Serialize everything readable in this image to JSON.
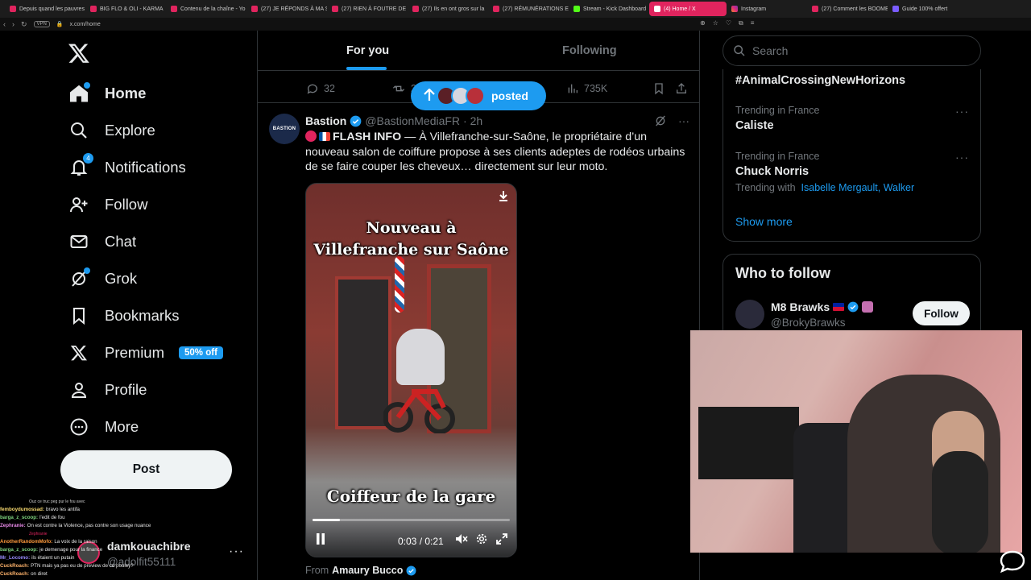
{
  "browser": {
    "tabs": [
      {
        "label": "Depuis quand les pauvres",
        "kind": "yt"
      },
      {
        "label": "BIG FLO & OLI - KARMA",
        "kind": "yt"
      },
      {
        "label": "Contenu de la chaîne - Yo",
        "kind": "yt"
      },
      {
        "label": "(27) JE RÉPONDS À MA S",
        "kind": "yt"
      },
      {
        "label": "(27) RIEN À FOUTRE DE T",
        "kind": "yt"
      },
      {
        "label": "(27) Ils en ont gros sur la",
        "kind": "yt"
      },
      {
        "label": "(27) RÉMUNÉRATIONS ET",
        "kind": "yt"
      },
      {
        "label": "Stream - Kick Dashboard",
        "kind": "kick"
      },
      {
        "label": "(4) Home / X",
        "kind": "x",
        "active": true
      },
      {
        "label": "Instagram",
        "kind": "insta"
      },
      {
        "label": "(27) Comment les BOOME",
        "kind": "yt"
      },
      {
        "label": "Guide 100% offert",
        "kind": "guide"
      }
    ],
    "vpn": "VPN",
    "url": "x.com/home"
  },
  "nav": {
    "home": "Home",
    "explore": "Explore",
    "notifications": "Notifications",
    "notifications_count": "4",
    "follow": "Follow",
    "chat": "Chat",
    "grok": "Grok",
    "bookmarks": "Bookmarks",
    "premium": "Premium",
    "premium_badge": "50% off",
    "profile": "Profile",
    "more": "More",
    "post_button": "Post"
  },
  "account": {
    "name": "damkouachibre",
    "handle": "@adolfit55111",
    "more": "···"
  },
  "chat_overlay": [
    {
      "user": "",
      "color": "#ccc",
      "text": "Ouz ce truc peg pur le fou avec"
    },
    {
      "user": "femboydumossad:",
      "color": "#f5d76e",
      "text": "bravo les antifa"
    },
    {
      "user": "barga_z_scoop:",
      "color": "#7fd37f",
      "text": "l'edit de fou"
    },
    {
      "user": "Zephranie:",
      "color": "#e889e8",
      "text": "On est contre la Violence, pas contre son usage nuance"
    },
    {
      "user": "",
      "color": "#e0245e",
      "text": "Zephranie"
    },
    {
      "user": "AnotherRandomMofo:",
      "color": "#ff9a3c",
      "text": "La voix de la raison"
    },
    {
      "user": "barga_z_scoop:",
      "color": "#7fd37f",
      "text": "je demenage  pour la finance"
    },
    {
      "user": "Mr_Locomo:",
      "color": "#9a8cff",
      "text": "ils étaient un putain"
    },
    {
      "user": "CuckRoach:",
      "color": "#ffb36b",
      "text": "PTN mais ya pas eu de preview de ce pouley?"
    },
    {
      "user": "CuckRoach:",
      "color": "#ffb36b",
      "text": "on diret"
    }
  ],
  "feed": {
    "tab_for_you": "For you",
    "tab_following": "Following",
    "prev_actions": {
      "replies": "32",
      "reposts": "2",
      "views": "735K"
    },
    "posted_pill": "posted",
    "tweet": {
      "avatar_text": "BASTION",
      "name": "Bastion",
      "handle": "@BastionMediaFR",
      "time": "· 2h",
      "lead": "FLASH INFO",
      "body": " — À Villefranche-sur-Saône, le propriétaire d’un nouveau salon de coiffure propose à ses clients adeptes de rodéos urbains de se faire couper les cheveux… directement sur leur moto.",
      "video": {
        "caption_top_1": "Nouveau à",
        "caption_top_2": "Villefranche sur Saône",
        "caption_bottom": "Coiffeur de la gare",
        "time": "0:03 / 0:21",
        "progress": 0.14
      },
      "from_label": "From",
      "from_name": "Amaury Bucco"
    }
  },
  "sidebar": {
    "search_placeholder": "Search",
    "trends": [
      {
        "meta": "",
        "title": "#AnimalCrossingNewHorizons",
        "with": []
      },
      {
        "meta": "Trending in France",
        "title": "Caliste",
        "with": []
      },
      {
        "meta": "Trending in France",
        "title": "Chuck Norris",
        "with_label": "Trending with",
        "with": [
          "Isabelle Mergault",
          "Walker"
        ]
      }
    ],
    "show_more": "Show more",
    "who_to_follow": {
      "heading": "Who to follow",
      "name": "M8 Brawks",
      "handle": "@BrokyBrawks",
      "follow": "Follow"
    }
  },
  "colors": {
    "accent": "#1d9bf0",
    "bg": "#000000",
    "text": "#e7e9ea",
    "muted": "#71767b",
    "border": "#2f3336"
  }
}
